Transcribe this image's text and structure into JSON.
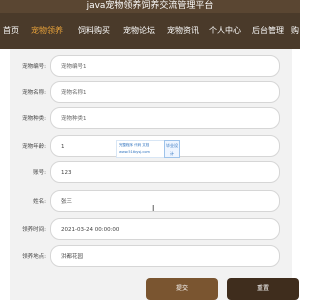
{
  "app": {
    "title": "java宠物领养饲养交流管理平台"
  },
  "nav": {
    "items": [
      {
        "label": "首页",
        "active": false
      },
      {
        "label": "宠物领养",
        "active": true
      },
      {
        "label": "饲料购买",
        "active": false
      },
      {
        "label": "宠物论坛",
        "active": false
      },
      {
        "label": "宠物资讯",
        "active": false
      },
      {
        "label": "个人中心",
        "active": false
      },
      {
        "label": "后台管理",
        "active": false
      },
      {
        "label": "购",
        "active": false
      }
    ]
  },
  "form": {
    "rows": [
      {
        "label": "宠物编号:",
        "value": "宠物编号1"
      },
      {
        "label": "宠物名称:",
        "value": "宠物名称1"
      },
      {
        "label": "宠物种类:",
        "value": "宠物种类1"
      },
      {
        "label": "宠物年龄:",
        "value": "1"
      },
      {
        "label": "账号:",
        "value": "123"
      },
      {
        "label": "姓名:",
        "value": "张三"
      },
      {
        "label": "领养时间:",
        "value": "2021-03-24 00:00:00"
      },
      {
        "label": "领养地点:",
        "value": "洪都花园"
      }
    ],
    "submit_label": "提交",
    "reset_label": "重置"
  },
  "watermark": {
    "line1": "完整程序 代码 文档",
    "line2": "www.51tbysj.com",
    "badge": "毕业设计"
  },
  "colors": {
    "nav_bg": "#4a3a2a",
    "active": "#e8a23a",
    "submit": "#7a5530",
    "reset": "#3f2d1d"
  }
}
